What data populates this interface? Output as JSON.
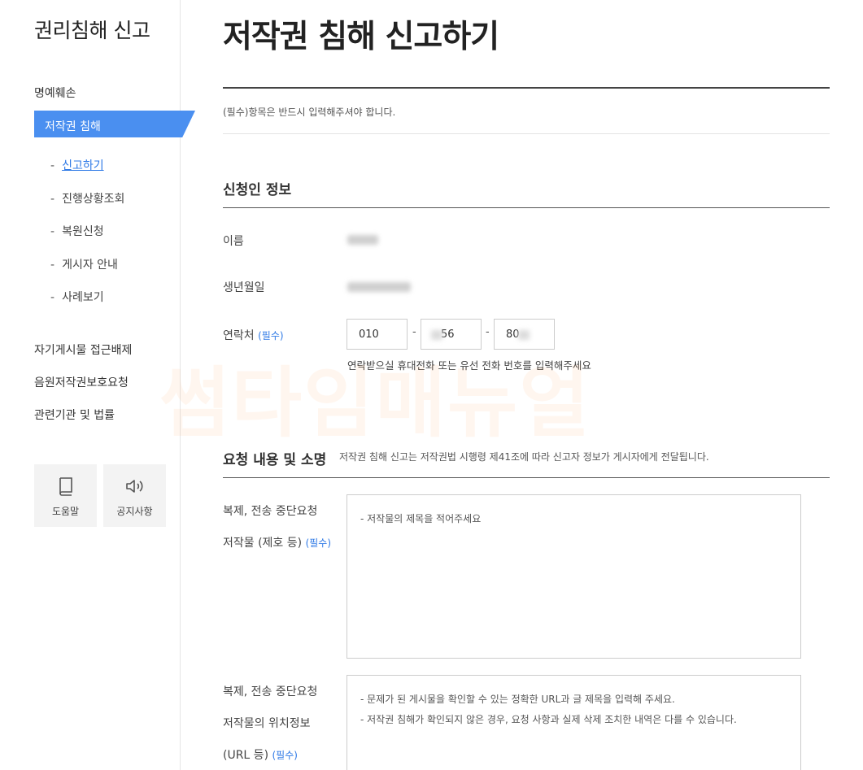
{
  "sidebar": {
    "title": "권리침해 신고",
    "menu": [
      "명예훼손",
      "저작권 침해"
    ],
    "active_menu": "저작권 침해",
    "sub_items": [
      "신고하기",
      "진행상황조회",
      "복원신청",
      "게시자 안내",
      "사례보기"
    ],
    "sub_dash": "-",
    "other_menu": [
      "자기게시물 접근배제",
      "음원저작권보호요청",
      "관련기관 및 법률"
    ],
    "help_label": "도움말",
    "notice_label": "공지사항"
  },
  "main": {
    "title": "저작권 침해 신고하기",
    "required_notice": "(필수)항목은 반드시 입력해주셔야 합니다.",
    "applicant_section": "신청인 정보",
    "name_label": "이름",
    "birth_label": "생년월일",
    "contact_label": "연락처",
    "required_tag": "(필수)",
    "phone": {
      "part1": "010",
      "part2": "56",
      "part3": "80",
      "separator": "-"
    },
    "contact_hint": "연락받으실 휴대전화 또는 유선 전화 번호를 입력해주세요",
    "request_section": "요청 내용 및 소명",
    "request_desc": "저작권 침해 신고는 저작권법 시행령 제41조에 따라 신고자 정보가 게시자에게 전달됩니다.",
    "field1": {
      "label_line1": "복제, 전송 중단요청",
      "label_line2": "저작물 (제호 등)",
      "placeholder": "- 저작물의 제목을 적어주세요"
    },
    "field2": {
      "label_line1": "복제, 전송 중단요청",
      "label_line2": "저작물의 위치정보",
      "label_line3": "(URL 등)",
      "placeholder_line1": "- 문제가 된 게시물을 확인할 수 있는 정확한 URL과 글 제목을 입력해 주세요.",
      "placeholder_line2": "- 저작권 침해가 확인되지 않은 경우, 요청 사항과 실제 삭제 조치한 내역은 다를 수 있습니다."
    },
    "watermark": "썸타임매뉴얼"
  },
  "colors": {
    "accent": "#4a8ff0",
    "required": "#2e79e6"
  }
}
